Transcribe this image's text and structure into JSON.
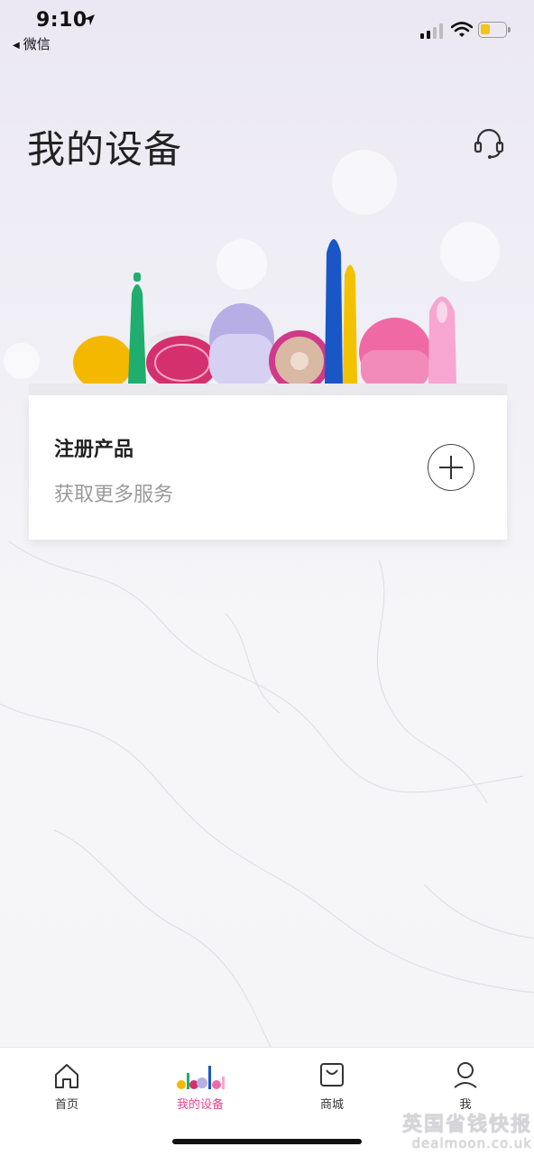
{
  "status": {
    "time": "9:10",
    "back_app": "微信"
  },
  "page": {
    "title": "我的设备"
  },
  "register_card": {
    "title": "注册产品",
    "subtitle": "获取更多服务"
  },
  "tabs": [
    {
      "label": "首页",
      "icon": "home-icon",
      "active": false
    },
    {
      "label": "我的设备",
      "icon": "devices-icon",
      "active": true
    },
    {
      "label": "商城",
      "icon": "shopping-bag-icon",
      "active": false
    },
    {
      "label": "我",
      "icon": "profile-icon",
      "active": false
    }
  ],
  "watermark": {
    "cn": "英国省钱快报",
    "en": "dealmoon.co.uk"
  },
  "colors": {
    "active_tab": "#e6458c",
    "card_bg": "#ffffff",
    "title_text": "#222222"
  }
}
